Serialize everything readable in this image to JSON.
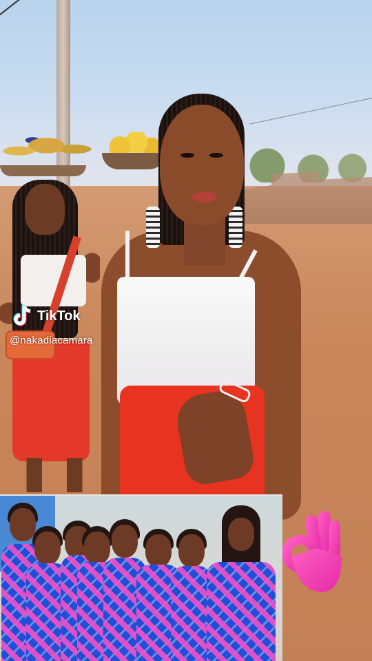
{
  "watermark": {
    "brand": "TikTok",
    "handle": "@nakadiacamara"
  },
  "overlays": {
    "ok_hand_emoji": "👌",
    "inset_photo": "group photo of women in matching blue and pink dresses"
  },
  "colors": {
    "skirt_red": "#e7331f",
    "top_white": "#f3f0ee",
    "dress_blue": "#1f4fd6",
    "dress_pink": "#f050c8",
    "emoji_pink": "#f03fb7"
  }
}
